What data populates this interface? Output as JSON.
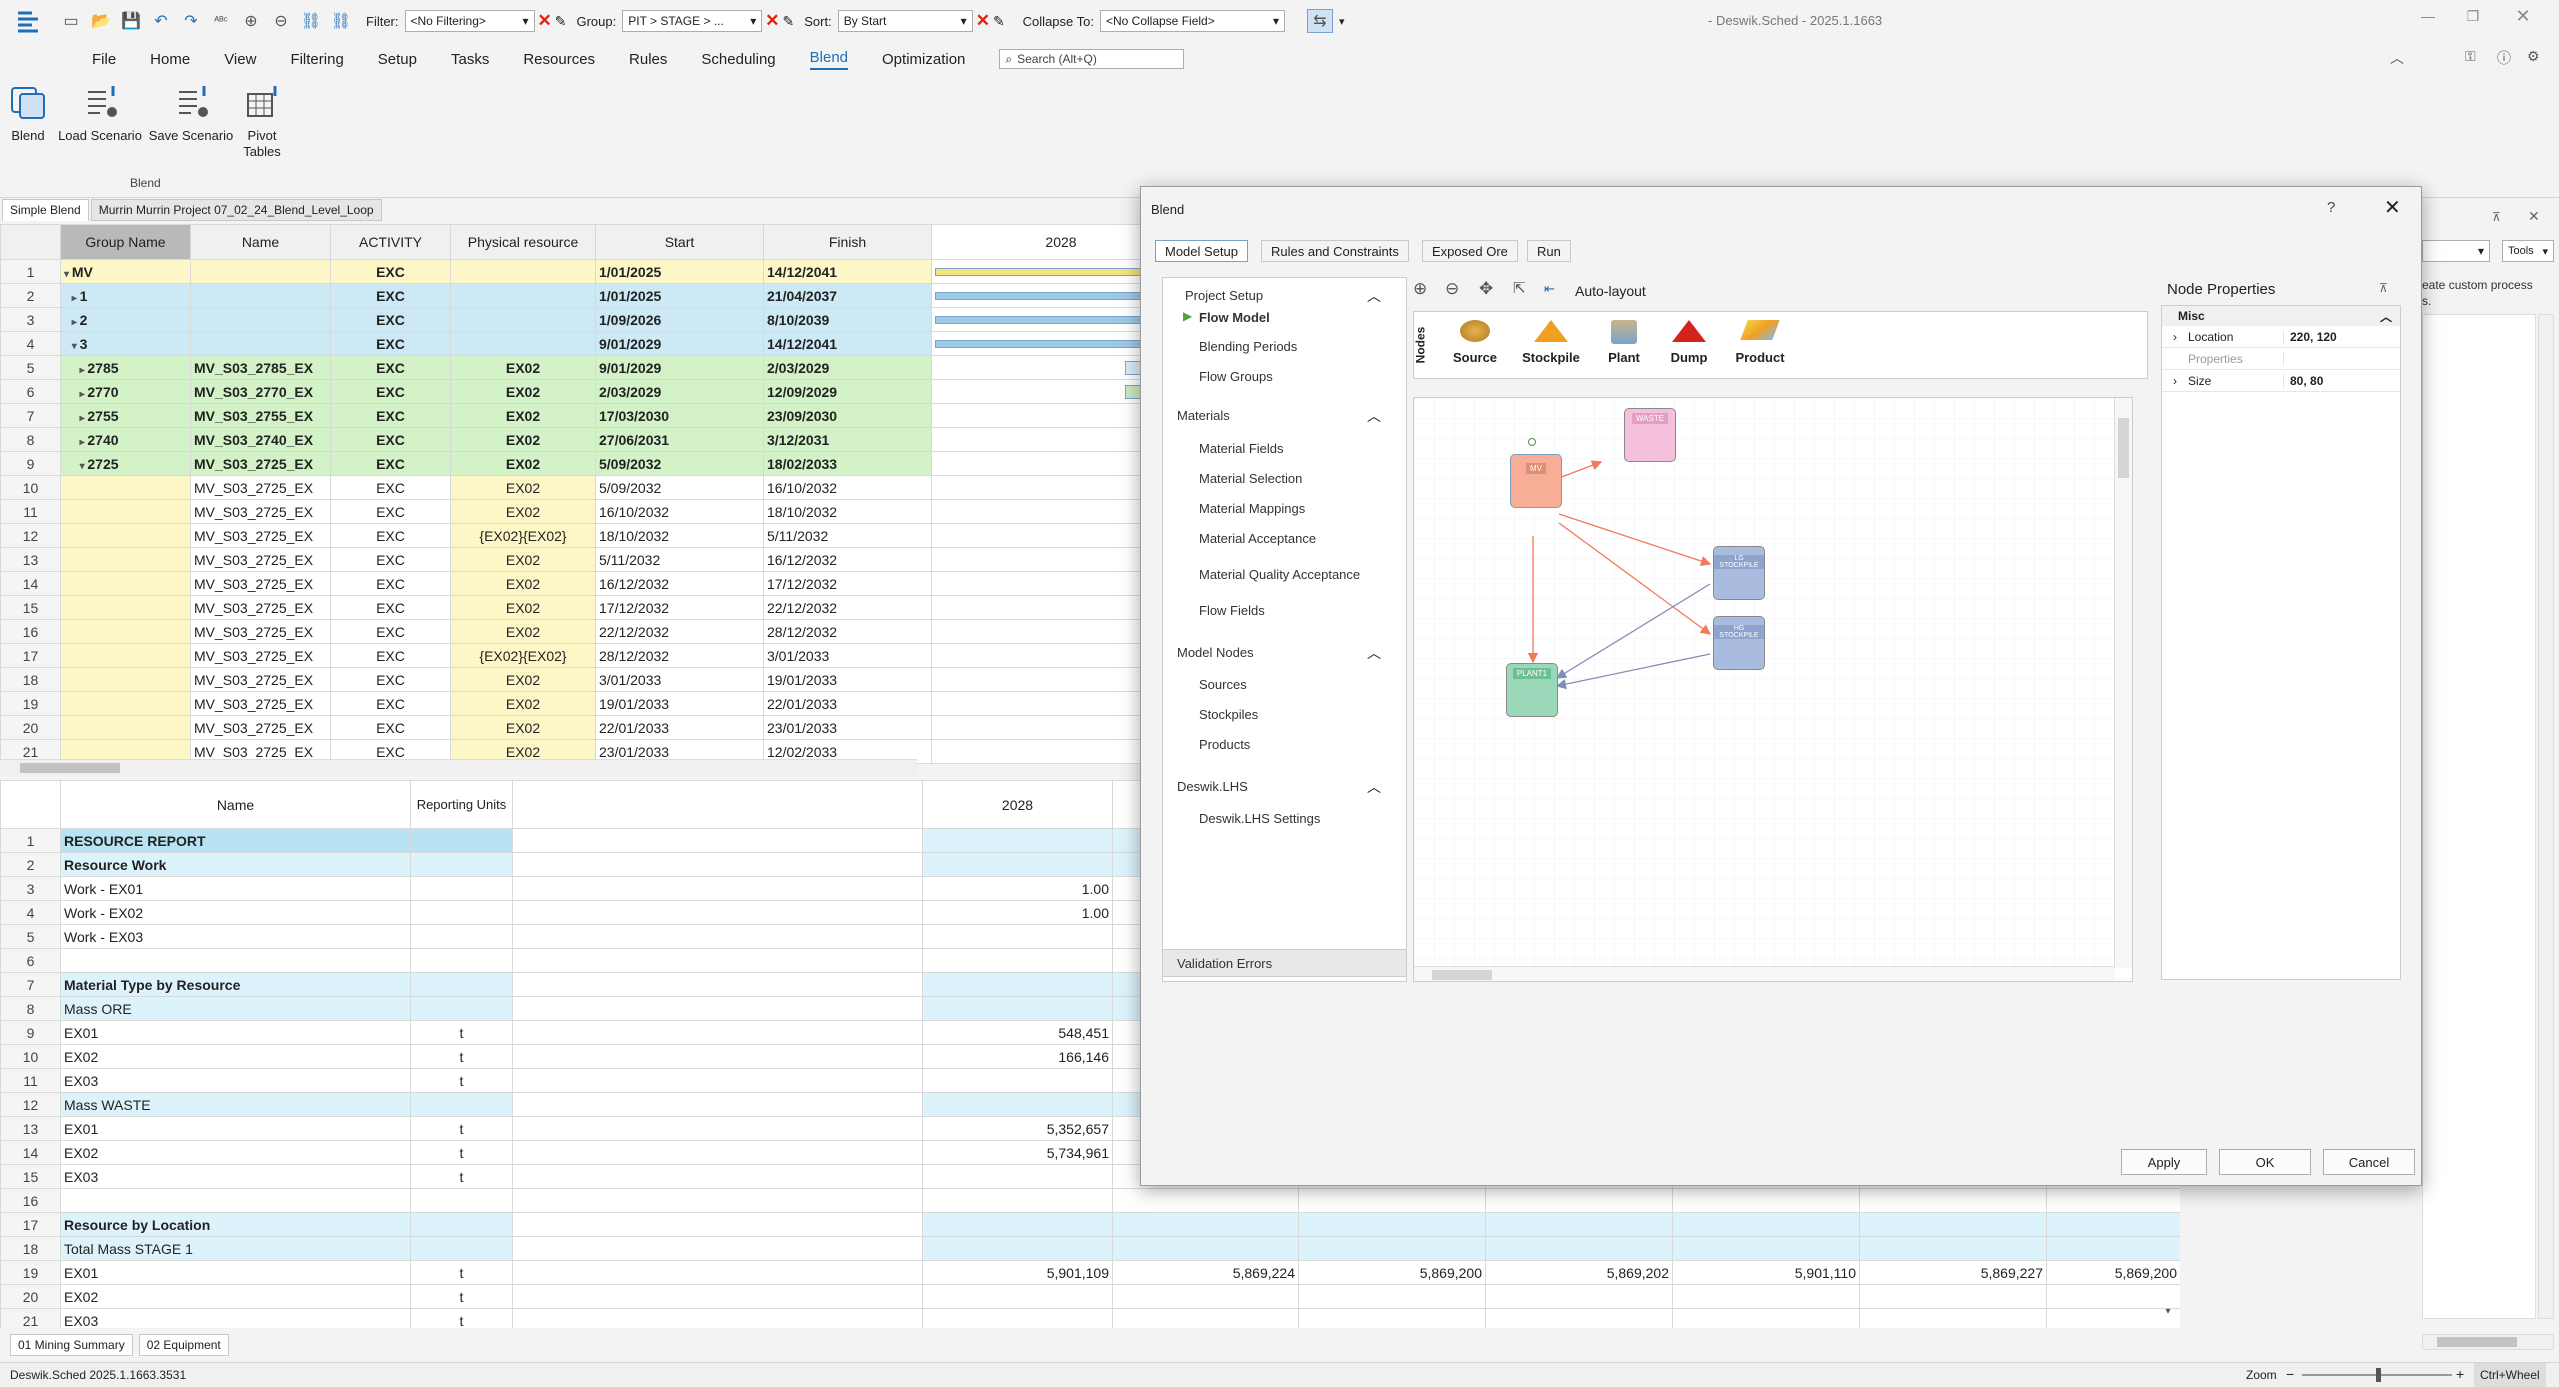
{
  "app": {
    "title": "- Deswik.Sched - 2025.1.1663",
    "status": "Deswik.Sched 2025.1.1663.3531",
    "zoom_label": "Zoom",
    "ctrl_wheel": "Ctrl+Wheel"
  },
  "toolbar": {
    "filter_label": "Filter:",
    "filter_value": "<No Filtering>",
    "group_label": "Group:",
    "group_value": "PIT > STAGE > ...",
    "sort_label": "Sort:",
    "sort_value": "By Start",
    "collapse_label": "Collapse To:",
    "collapse_value": "<No Collapse Field>"
  },
  "menu": [
    "File",
    "Home",
    "View",
    "Filtering",
    "Setup",
    "Tasks",
    "Resources",
    "Rules",
    "Scheduling",
    "Blend",
    "Optimization"
  ],
  "search": {
    "placeholder": "Search (Alt+Q)"
  },
  "ribbon": {
    "buttons": [
      "Blend",
      "Load Scenario",
      "Save Scenario",
      "Pivot Tables"
    ],
    "group_label": "Blend"
  },
  "doc_tabs": [
    "Simple Blend",
    "Murrin Murrin Project 07_02_24_Blend_Level_Loop"
  ],
  "gantt": {
    "headers": [
      "Group Name",
      "Name",
      "ACTIVITY",
      "Physical resource",
      "Start",
      "Finish",
      "2028"
    ],
    "rows": [
      [
        "1",
        "MV",
        "",
        "EXC",
        "",
        "1/01/2025",
        "14/12/2041"
      ],
      [
        "2",
        "1",
        "",
        "EXC",
        "",
        "1/01/2025",
        "21/04/2037"
      ],
      [
        "3",
        "2",
        "",
        "EXC",
        "",
        "1/09/2026",
        "8/10/2039"
      ],
      [
        "4",
        "3",
        "",
        "EXC",
        "",
        "9/01/2029",
        "14/12/2041"
      ],
      [
        "5",
        "2785",
        "MV_S03_2785_EX",
        "EXC",
        "EX02",
        "9/01/2029",
        "2/03/2029"
      ],
      [
        "6",
        "2770",
        "MV_S03_2770_EX",
        "EXC",
        "EX02",
        "2/03/2029",
        "12/09/2029"
      ],
      [
        "7",
        "2755",
        "MV_S03_2755_EX",
        "EXC",
        "EX02",
        "17/03/2030",
        "23/09/2030"
      ],
      [
        "8",
        "2740",
        "MV_S03_2740_EX",
        "EXC",
        "EX02",
        "27/06/2031",
        "3/12/2031"
      ],
      [
        "9",
        "2725",
        "MV_S03_2725_EX",
        "EXC",
        "EX02",
        "5/09/2032",
        "18/02/2033"
      ],
      [
        "10",
        "",
        "MV_S03_2725_EX",
        "EXC",
        "EX02",
        "5/09/2032",
        "16/10/2032"
      ],
      [
        "11",
        "",
        "MV_S03_2725_EX",
        "EXC",
        "EX02",
        "16/10/2032",
        "18/10/2032"
      ],
      [
        "12",
        "",
        "MV_S03_2725_EX",
        "EXC",
        "{EX02}{EX02}",
        "18/10/2032",
        "5/11/2032"
      ],
      [
        "13",
        "",
        "MV_S03_2725_EX",
        "EXC",
        "EX02",
        "5/11/2032",
        "16/12/2032"
      ],
      [
        "14",
        "",
        "MV_S03_2725_EX",
        "EXC",
        "EX02",
        "16/12/2032",
        "17/12/2032"
      ],
      [
        "15",
        "",
        "MV_S03_2725_EX",
        "EXC",
        "EX02",
        "17/12/2032",
        "22/12/2032"
      ],
      [
        "16",
        "",
        "MV_S03_2725_EX",
        "EXC",
        "EX02",
        "22/12/2032",
        "28/12/2032"
      ],
      [
        "17",
        "",
        "MV_S03_2725_EX",
        "EXC",
        "{EX02}{EX02}",
        "28/12/2032",
        "3/01/2033"
      ],
      [
        "18",
        "",
        "MV_S03_2725_EX",
        "EXC",
        "EX02",
        "3/01/2033",
        "19/01/2033"
      ],
      [
        "19",
        "",
        "MV_S03_2725_EX",
        "EXC",
        "EX02",
        "19/01/2033",
        "22/01/2033"
      ],
      [
        "20",
        "",
        "MV_S03_2725_EX",
        "EXC",
        "EX02",
        "22/01/2033",
        "23/01/2033"
      ],
      [
        "21",
        "",
        "MV_S03_2725_EX",
        "EXC",
        "EX02",
        "23/01/2033",
        "12/02/2033"
      ]
    ]
  },
  "report": {
    "headers": [
      "Name",
      "Reporting Units",
      "2028"
    ],
    "rows": [
      [
        "1",
        "RESOURCE REPORT",
        "",
        ""
      ],
      [
        "2",
        "Resource Work",
        "",
        ""
      ],
      [
        "3",
        "Work - EX01",
        "",
        "1.00"
      ],
      [
        "4",
        "Work - EX02",
        "",
        "1.00"
      ],
      [
        "5",
        "Work - EX03",
        "",
        ""
      ],
      [
        "6",
        "",
        "",
        ""
      ],
      [
        "7",
        "Material Type by Resource",
        "",
        ""
      ],
      [
        "8",
        "Mass ORE",
        "",
        ""
      ],
      [
        "9",
        "EX01",
        "t",
        "548,451"
      ],
      [
        "10",
        "EX02",
        "t",
        "166,146"
      ],
      [
        "11",
        "EX03",
        "t",
        ""
      ],
      [
        "12",
        "Mass WASTE",
        "",
        ""
      ],
      [
        "13",
        "EX01",
        "t",
        "5,352,657"
      ],
      [
        "14",
        "EX02",
        "t",
        "5,734,961"
      ],
      [
        "15",
        "EX03",
        "t",
        ""
      ],
      [
        "16",
        "",
        "",
        ""
      ],
      [
        "17",
        "Resource by Location",
        "",
        ""
      ],
      [
        "18",
        "Total Mass STAGE 1",
        "",
        ""
      ],
      [
        "19",
        "EX01",
        "t",
        "5,901,109"
      ],
      [
        "20",
        "EX02",
        "t",
        ""
      ],
      [
        "21",
        "EX03",
        "t",
        ""
      ]
    ],
    "row19_extra": [
      "5,869,224",
      "5,869,200",
      "5,869,202",
      "5,901,110",
      "5,869,227",
      "5,869,200"
    ]
  },
  "bottom_tabs": [
    "01 Mining Summary",
    "02 Equipment"
  ],
  "right_panel": {
    "tools": "Tools",
    "hint": "eate custom process",
    "hint2": "s."
  },
  "blend": {
    "title": "Blend",
    "tabs": [
      "Model Setup",
      "Rules and Constraints",
      "Exposed Ore",
      "Run"
    ],
    "nav": {
      "project_setup": "Project Setup",
      "flow_model": "Flow Model",
      "blending_periods": "Blending Periods",
      "flow_groups": "Flow Groups",
      "materials": "Materials",
      "material_fields": "Material Fields",
      "material_selection": "Material Selection",
      "material_mappings": "Material Mappings",
      "material_acceptance": "Material Acceptance",
      "material_quality_acceptance": "Material Quality Acceptance",
      "flow_fields": "Flow Fields",
      "model_nodes": "Model Nodes",
      "sources": "Sources",
      "stockpiles": "Stockpiles",
      "products": "Products",
      "lhs": "Deswik.LHS",
      "lhs_settings": "Deswik.LHS Settings",
      "validation": "Validation Errors"
    },
    "autolayout": "Auto-layout",
    "palette_title": "Nodes",
    "palette": [
      "Source",
      "Stockpile",
      "Plant",
      "Dump",
      "Product"
    ],
    "nodes": {
      "mv": "MV",
      "waste": "WASTE",
      "lg": "LG STOCKPILE",
      "hg": "HG STOCKPILE",
      "plant": "PLANT1"
    },
    "props": {
      "title": "Node Properties",
      "misc": "Misc",
      "location_label": "Location",
      "location_value": "220, 120",
      "properties_label": "Properties",
      "size_label": "Size",
      "size_value": "80, 80"
    },
    "buttons": {
      "apply": "Apply",
      "ok": "OK",
      "cancel": "Cancel"
    }
  },
  "colors": {
    "accent": "#1e6fb8",
    "yellow": "#fdf7c8",
    "blue": "#cde9f6",
    "green": "#d3f2c8",
    "arrow": "#f07a5a"
  }
}
